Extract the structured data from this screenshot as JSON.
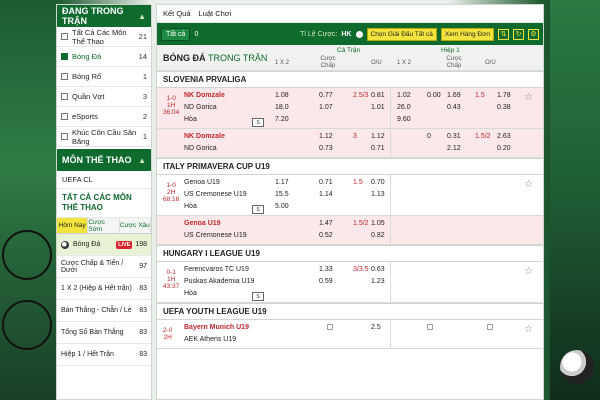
{
  "sidebar": {
    "header": "ĐANG TRONG TRẬN",
    "items": [
      {
        "label": "Tất Cả Các Môn Thể Thao",
        "count": "21",
        "checked": false,
        "active": false
      },
      {
        "label": "Bóng Đá",
        "count": "14",
        "checked": true,
        "active": true
      },
      {
        "label": "Bóng Rổ",
        "count": "1",
        "checked": false,
        "active": false
      },
      {
        "label": "Quần Vợt",
        "count": "3",
        "checked": false,
        "active": false
      },
      {
        "label": "eSports",
        "count": "2",
        "checked": false,
        "active": false
      },
      {
        "label": "Khúc Côn Cầu Sân Băng",
        "count": "1",
        "checked": false,
        "active": false
      }
    ],
    "sports_header": "MÔN THỂ THAO",
    "uefa": "UEFA CL",
    "all_sports": "TẤT CẢ CÁC MÔN THỂ THAO",
    "tabs": [
      "Hôm Nay",
      "Cược Sớm",
      "Cược Xâu"
    ],
    "rows": [
      {
        "label": "Bóng Đá",
        "badge": "LIVE",
        "count": "198"
      },
      {
        "label": "Cược Chấp & Tiến / Dưới",
        "count": "97"
      },
      {
        "label": "1 X 2 (Hiệp & Hết trận)",
        "count": "83"
      },
      {
        "label": "Bàn Thắng - Chẵn / Lẻ",
        "count": "83"
      },
      {
        "label": "Tổng Số Bàn Thắng",
        "count": "83"
      },
      {
        "label": "Hiệp 1 / Hết Trận",
        "count": "83"
      }
    ]
  },
  "nav": {
    "results": "Kết Quả",
    "rules": "Luật Chơi"
  },
  "toolbar": {
    "all_label": "Tất cả",
    "all_count": "0",
    "odds_label": "Tỉ Lệ Cược:",
    "odds_value": "HK",
    "choose_btn": "Chọn Giải Đấu",
    "choose_value": "Tất cả",
    "sort_btn": "Xem Hàng Đơn"
  },
  "header": {
    "title": "BÓNG ĐÁ",
    "title_sub": "TRONG TRẬN",
    "full_time": "Cả Trận",
    "half": "Hiệp 1",
    "col_1x2": "1 X 2",
    "col_handicap": "Cược Chấp",
    "col_ou": "O/U"
  },
  "leagues": [
    {
      "name": "SLOVENIA PRVALIGA",
      "matches": [
        {
          "bg": "pink",
          "time": [
            "1-0",
            "1H",
            "36:04"
          ],
          "lines": [
            {
              "team": "NK Domzale",
              "red": true,
              "x12": "1.08",
              "hc": "0.77",
              "hcl": "2.5/3",
              "ou": "0.81",
              "h_x12": "1.02",
              "h_hc": "0.00",
              "h_hcv": "1.69",
              "h_ou": "1.5",
              "h_ouv": "1.78"
            },
            {
              "team": "ND Gorica",
              "red": false,
              "x12": "18.0",
              "hc": "1.07",
              "hcl": "",
              "ou": "1.01",
              "h_x12": "26.0",
              "h_hc": "",
              "h_hcv": "0.43",
              "h_ou": "",
              "h_ouv": "0.38"
            },
            {
              "team": "Hòa",
              "red": false,
              "x12": "7.20",
              "hc": "",
              "hcl": "",
              "ou": "",
              "h_x12": "9.60",
              "h_hc": "",
              "h_hcv": "",
              "h_ou": "",
              "h_ouv": ""
            }
          ]
        },
        {
          "bg": "pink",
          "time": [
            "",
            "",
            ""
          ],
          "lines": [
            {
              "team": "NK Domzale",
              "red": true,
              "x12": "",
              "hc": "1.12",
              "hcl": "3",
              "ou": "1.12",
              "h_x12": "",
              "h_hc": "0",
              "h_hcv": "0.31",
              "h_ou": "1.5/2",
              "h_ouv": "2.63"
            },
            {
              "team": "ND Gorica",
              "red": false,
              "x12": "",
              "hc": "0.73",
              "hcl": "",
              "ou": "0.71",
              "h_x12": "",
              "h_hc": "",
              "h_hcv": "2.12",
              "h_ou": "",
              "h_ouv": "0.20"
            }
          ]
        }
      ]
    },
    {
      "name": "ITALY PRIMAVERA CUP U19",
      "matches": [
        {
          "bg": "white",
          "time": [
            "1-0",
            "2H",
            "68:16"
          ],
          "lines": [
            {
              "team": "Genoa U19",
              "red": false,
              "x12": "1.17",
              "hc": "0.71",
              "hcl": "1.5",
              "ou": "0.70",
              "h_x12": "",
              "h_hc": "",
              "h_hcv": "",
              "h_ou": "",
              "h_ouv": ""
            },
            {
              "team": "US Cremonese U19",
              "red": false,
              "x12": "15.5",
              "hc": "1.14",
              "hcl": "",
              "ou": "1.13",
              "h_x12": "",
              "h_hc": "",
              "h_hcv": "",
              "h_ou": "",
              "h_ouv": ""
            },
            {
              "team": "Hòa",
              "red": false,
              "x12": "5.00",
              "hc": "",
              "hcl": "",
              "ou": "",
              "h_x12": "",
              "h_hc": "",
              "h_hcv": "",
              "h_ou": "",
              "h_ouv": ""
            }
          ]
        },
        {
          "bg": "pink",
          "time": [
            "",
            "",
            ""
          ],
          "lines": [
            {
              "team": "Genoa U19",
              "red": true,
              "x12": "",
              "hc": "1.47",
              "hcl": "1.5/2",
              "ou": "1.05",
              "h_x12": "",
              "h_hc": "",
              "h_hcv": "",
              "h_ou": "",
              "h_ouv": ""
            },
            {
              "team": "US Cremonese U19",
              "red": false,
              "x12": "",
              "hc": "0.52",
              "hcl": "",
              "ou": "0.82",
              "h_x12": "",
              "h_hc": "",
              "h_hcv": "",
              "h_ou": "",
              "h_ouv": ""
            }
          ]
        }
      ]
    },
    {
      "name": "HUNGARY I LEAGUE U19",
      "matches": [
        {
          "bg": "white",
          "time": [
            "0-1",
            "1H",
            "43:37"
          ],
          "lines": [
            {
              "team": "Ferencvaros TC U19",
              "red": false,
              "x12": "",
              "hc": "1.33",
              "hcl": "3/3.5",
              "ou": "0.63",
              "h_x12": "",
              "h_hc": "",
              "h_hcv": "",
              "h_ou": "",
              "h_ouv": ""
            },
            {
              "team": "Puskas Akademia U19",
              "red": false,
              "x12": "",
              "hc": "0.59",
              "hcl": "",
              "ou": "1.23",
              "h_x12": "",
              "h_hc": "",
              "h_hcv": "",
              "h_ou": "",
              "h_ouv": ""
            },
            {
              "team": "Hòa",
              "red": false,
              "x12": "",
              "hc": "",
              "hcl": "",
              "ou": "",
              "h_x12": "",
              "h_hc": "",
              "h_hcv": "",
              "h_ou": "",
              "h_ouv": ""
            }
          ]
        }
      ]
    },
    {
      "name": "UEFA YOUTH LEAGUE U19",
      "matches": [
        {
          "bg": "white",
          "time": [
            "2-0",
            "2H",
            ""
          ],
          "lines": [
            {
              "team": "Bayern Munich U19",
              "red": true,
              "x12": "",
              "hc": "",
              "hcl": "",
              "ou": "2.5",
              "h_x12": "",
              "h_hc": "",
              "h_hcv": "",
              "h_ou": "",
              "h_ouv": ""
            },
            {
              "team": "AEK Athens U19",
              "red": false,
              "x12": "",
              "hc": "",
              "hcl": "",
              "ou": "",
              "h_x12": "",
              "h_hc": "",
              "h_hcv": "",
              "h_ou": "",
              "h_ouv": ""
            }
          ]
        }
      ]
    }
  ],
  "icons": {
    "star": "star-icon",
    "refresh": "refresh-icon",
    "settings": "settings-icon",
    "stats": "stats-icon",
    "lock": "lock-icon"
  },
  "colors": {
    "brand_green": "#0f6a2e",
    "accent_yellow": "#f3e43d",
    "live_red": "#d8232a",
    "row_pink": "#fbe8ea"
  }
}
